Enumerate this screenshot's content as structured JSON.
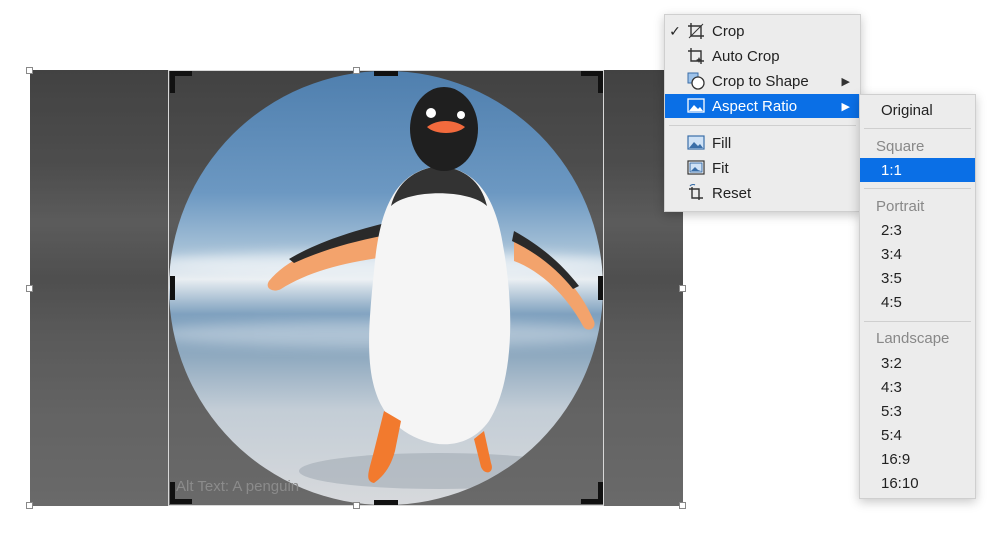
{
  "image": {
    "alt_text": "Alt Text: A penguin"
  },
  "menu": {
    "items": [
      {
        "label": "Crop",
        "icon": "crop-icon",
        "checked": true
      },
      {
        "label": "Auto Crop",
        "icon": "auto-crop-icon"
      },
      {
        "label": "Crop to Shape",
        "icon": "crop-to-shape-icon",
        "has_submenu": true
      },
      {
        "label": "Aspect Ratio",
        "icon": "aspect-ratio-icon",
        "has_submenu": true,
        "selected": true
      },
      {
        "label": "Fill",
        "icon": "fill-icon"
      },
      {
        "label": "Fit",
        "icon": "fit-icon"
      },
      {
        "label": "Reset",
        "icon": "reset-icon"
      }
    ],
    "check_mark": "✓",
    "submenu_arrow": "▶"
  },
  "submenu": {
    "original": "Original",
    "square_header": "Square",
    "square": [
      "1:1"
    ],
    "portrait_header": "Portrait",
    "portrait": [
      "2:3",
      "3:4",
      "3:5",
      "4:5"
    ],
    "landscape_header": "Landscape",
    "landscape": [
      "3:2",
      "4:3",
      "5:3",
      "5:4",
      "16:9",
      "16:10"
    ],
    "selected": "1:1"
  },
  "colors": {
    "selection_blue": "#0a6fe6",
    "menu_background": "#ececec",
    "beak_orange": "#f26a3d"
  }
}
